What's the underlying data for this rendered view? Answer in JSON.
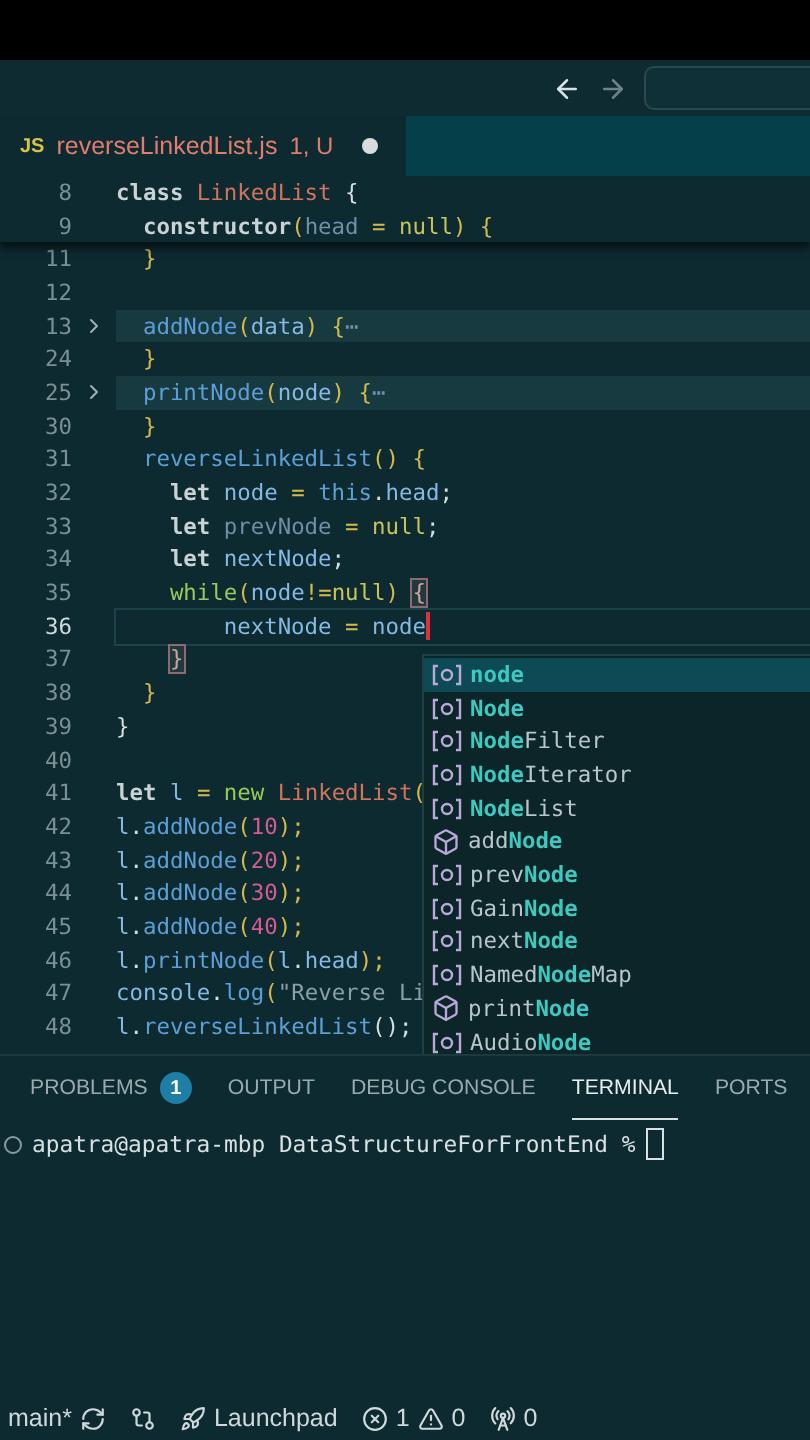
{
  "editor_tab": {
    "lang": "JS",
    "file": "reverseLinkedList.js",
    "status": "1, U",
    "dirty": true
  },
  "sticky_lines": [
    {
      "number": "8",
      "folded": false,
      "current": false,
      "tokens": [
        {
          "text": "class ",
          "kind": "kw"
        },
        {
          "text": "LinkedList",
          "kind": "cls"
        },
        {
          "text": " {",
          "kind": "punct"
        }
      ]
    },
    {
      "number": "9",
      "folded": false,
      "current": false,
      "tokens": [
        {
          "text": "  constructor",
          "kind": "kw"
        },
        {
          "text": "(",
          "kind": "paren"
        },
        {
          "text": "head",
          "kind": "dim"
        },
        {
          "text": " = ",
          "kind": "op"
        },
        {
          "text": "null",
          "kind": "lit"
        },
        {
          "text": ") {",
          "kind": "paren"
        }
      ]
    }
  ],
  "lines": [
    {
      "number": "11",
      "folded": false,
      "current": false,
      "tokens": [
        {
          "text": "  }",
          "kind": "paren"
        }
      ]
    },
    {
      "number": "12",
      "folded": false,
      "current": false
    },
    {
      "number": "13",
      "folded": true,
      "current": false,
      "tokens": [
        {
          "text": "  addNode",
          "kind": "fn"
        },
        {
          "text": "(",
          "kind": "paren"
        },
        {
          "text": "data",
          "kind": "var"
        },
        {
          "text": ") {",
          "kind": "paren"
        },
        {
          "text": "⋯",
          "kind": "dim"
        }
      ]
    },
    {
      "number": "24",
      "folded": false,
      "current": false,
      "tokens": [
        {
          "text": "  }",
          "kind": "paren"
        }
      ]
    },
    {
      "number": "25",
      "folded": true,
      "current": false,
      "tokens": [
        {
          "text": "  printNode",
          "kind": "fn"
        },
        {
          "text": "(",
          "kind": "paren"
        },
        {
          "text": "node",
          "kind": "var"
        },
        {
          "text": ") {",
          "kind": "paren"
        },
        {
          "text": "⋯",
          "kind": "dim"
        }
      ]
    },
    {
      "number": "30",
      "folded": false,
      "current": false,
      "tokens": [
        {
          "text": "  }",
          "kind": "paren"
        }
      ]
    },
    {
      "number": "31",
      "folded": false,
      "current": false,
      "tokens": [
        {
          "text": "  reverseLinkedList",
          "kind": "fn"
        },
        {
          "text": "() {",
          "kind": "paren"
        }
      ]
    },
    {
      "number": "32",
      "folded": false,
      "current": false,
      "tokens": [
        {
          "text": "    let ",
          "kind": "kw"
        },
        {
          "text": "node",
          "kind": "var"
        },
        {
          "text": " = ",
          "kind": "op"
        },
        {
          "text": "this",
          "kind": "fn"
        },
        {
          "text": ".",
          "kind": "punct"
        },
        {
          "text": "head",
          "kind": "var"
        },
        {
          "text": ";",
          "kind": "punct"
        }
      ]
    },
    {
      "number": "33",
      "folded": false,
      "current": false,
      "tokens": [
        {
          "text": "    let ",
          "kind": "kw"
        },
        {
          "text": "prevNode",
          "kind": "dim"
        },
        {
          "text": " = ",
          "kind": "op"
        },
        {
          "text": "null",
          "kind": "lit"
        },
        {
          "text": ";",
          "kind": "punct"
        }
      ]
    },
    {
      "number": "34",
      "folded": false,
      "current": false,
      "tokens": [
        {
          "text": "    let ",
          "kind": "kw"
        },
        {
          "text": "nextNode",
          "kind": "var"
        },
        {
          "text": ";",
          "kind": "punct"
        }
      ]
    },
    {
      "number": "35",
      "folded": false,
      "current": false,
      "tokens": [
        {
          "text": "    while",
          "kind": "ctl"
        },
        {
          "text": "(",
          "kind": "paren"
        },
        {
          "text": "node",
          "kind": "var"
        },
        {
          "text": "!=",
          "kind": "op"
        },
        {
          "text": "null",
          "kind": "lit"
        },
        {
          "text": ") ",
          "kind": "paren"
        },
        {
          "text": "{",
          "kind": "match"
        }
      ]
    },
    {
      "number": "36",
      "folded": false,
      "current": true,
      "tokens": [
        {
          "text": "        nextNode",
          "kind": "var"
        },
        {
          "text": " = ",
          "kind": "op"
        },
        {
          "text": "node",
          "kind": "var"
        }
      ]
    },
    {
      "number": "37",
      "folded": false,
      "current": false,
      "tokens": [
        {
          "text": "    }",
          "kind": "match"
        }
      ]
    },
    {
      "number": "38",
      "folded": false,
      "current": false,
      "tokens": [
        {
          "text": "  }",
          "kind": "paren"
        }
      ]
    },
    {
      "number": "39",
      "folded": false,
      "current": false,
      "tokens": [
        {
          "text": "}",
          "kind": "punct"
        }
      ]
    },
    {
      "number": "40",
      "folded": false,
      "current": false
    },
    {
      "number": "41",
      "folded": false,
      "current": false,
      "tokens": [
        {
          "text": "let ",
          "kind": "kw"
        },
        {
          "text": "l",
          "kind": "var"
        },
        {
          "text": " = ",
          "kind": "op"
        },
        {
          "text": "new ",
          "kind": "ctl"
        },
        {
          "text": "LinkedList",
          "kind": "cls"
        },
        {
          "text": "(",
          "kind": "paren"
        }
      ]
    },
    {
      "number": "42",
      "folded": false,
      "current": false,
      "tokens": [
        {
          "text": "l",
          "kind": "var"
        },
        {
          "text": ".",
          "kind": "punct"
        },
        {
          "text": "addNode",
          "kind": "fn"
        },
        {
          "text": "(",
          "kind": "paren"
        },
        {
          "text": "10",
          "kind": "num"
        },
        {
          "text": ");",
          "kind": "paren"
        }
      ]
    },
    {
      "number": "43",
      "folded": false,
      "current": false,
      "tokens": [
        {
          "text": "l",
          "kind": "var"
        },
        {
          "text": ".",
          "kind": "punct"
        },
        {
          "text": "addNode",
          "kind": "fn"
        },
        {
          "text": "(",
          "kind": "paren"
        },
        {
          "text": "20",
          "kind": "num"
        },
        {
          "text": ");",
          "kind": "paren"
        }
      ]
    },
    {
      "number": "44",
      "folded": false,
      "current": false,
      "tokens": [
        {
          "text": "l",
          "kind": "var"
        },
        {
          "text": ".",
          "kind": "punct"
        },
        {
          "text": "addNode",
          "kind": "fn"
        },
        {
          "text": "(",
          "kind": "paren"
        },
        {
          "text": "30",
          "kind": "num"
        },
        {
          "text": ");",
          "kind": "paren"
        }
      ]
    },
    {
      "number": "45",
      "folded": false,
      "current": false,
      "tokens": [
        {
          "text": "l",
          "kind": "var"
        },
        {
          "text": ".",
          "kind": "punct"
        },
        {
          "text": "addNode",
          "kind": "fn"
        },
        {
          "text": "(",
          "kind": "paren"
        },
        {
          "text": "40",
          "kind": "num"
        },
        {
          "text": ");",
          "kind": "paren"
        }
      ]
    },
    {
      "number": "46",
      "folded": false,
      "current": false,
      "tokens": [
        {
          "text": "l",
          "kind": "var"
        },
        {
          "text": ".",
          "kind": "punct"
        },
        {
          "text": "printNode",
          "kind": "fn"
        },
        {
          "text": "(",
          "kind": "paren"
        },
        {
          "text": "l",
          "kind": "var"
        },
        {
          "text": ".",
          "kind": "punct"
        },
        {
          "text": "head",
          "kind": "var"
        },
        {
          "text": ");",
          "kind": "paren"
        }
      ]
    },
    {
      "number": "47",
      "folded": false,
      "current": false,
      "tokens": [
        {
          "text": "console",
          "kind": "var"
        },
        {
          "text": ".",
          "kind": "punct"
        },
        {
          "text": "log",
          "kind": "fn"
        },
        {
          "text": "(",
          "kind": "paren"
        },
        {
          "text": "\"Reverse Li",
          "kind": "str"
        }
      ]
    },
    {
      "number": "48",
      "folded": false,
      "current": false,
      "tokens": [
        {
          "text": "l",
          "kind": "var"
        },
        {
          "text": ".",
          "kind": "punct"
        },
        {
          "text": "reverseLinkedList",
          "kind": "fn"
        },
        {
          "text": "();",
          "kind": "punct"
        }
      ]
    }
  ],
  "suggestions": [
    {
      "kind": "variable",
      "selected": true,
      "match": "node"
    },
    {
      "kind": "variable",
      "selected": false,
      "match": "Node"
    },
    {
      "kind": "variable",
      "selected": false,
      "match": "Node",
      "suffix": "Filter"
    },
    {
      "kind": "variable",
      "selected": false,
      "match": "Node",
      "suffix": "Iterator"
    },
    {
      "kind": "variable",
      "selected": false,
      "match": "Node",
      "suffix": "List"
    },
    {
      "kind": "method",
      "selected": false,
      "prefix": "add",
      "match": "Node"
    },
    {
      "kind": "variable",
      "selected": false,
      "prefix": "prev",
      "match": "Node"
    },
    {
      "kind": "variable",
      "selected": false,
      "prefix": "Gain",
      "match": "Node"
    },
    {
      "kind": "variable",
      "selected": false,
      "prefix": "next",
      "match": "Node"
    },
    {
      "kind": "variable",
      "selected": false,
      "prefix": "Named",
      "match": "Node",
      "suffix": "Map"
    },
    {
      "kind": "method",
      "selected": false,
      "prefix": "print",
      "match": "Node"
    },
    {
      "kind": "variable",
      "selected": false,
      "prefix": "Audio",
      "match": "Node"
    }
  ],
  "panel_tabs": [
    {
      "label": "PROBLEMS",
      "badge": "1",
      "selected": false
    },
    {
      "label": "OUTPUT",
      "selected": false
    },
    {
      "label": "DEBUG CONSOLE",
      "selected": false
    },
    {
      "label": "TERMINAL",
      "selected": true
    },
    {
      "label": "PORTS",
      "selected": false
    }
  ],
  "terminal": {
    "prompt": "apatra@apatra-mbp DataStructureForFrontEnd %"
  },
  "status_bar": {
    "branch": "main*",
    "launchpad": "Launchpad",
    "errors": "1",
    "warnings": "0",
    "ports": "0"
  }
}
